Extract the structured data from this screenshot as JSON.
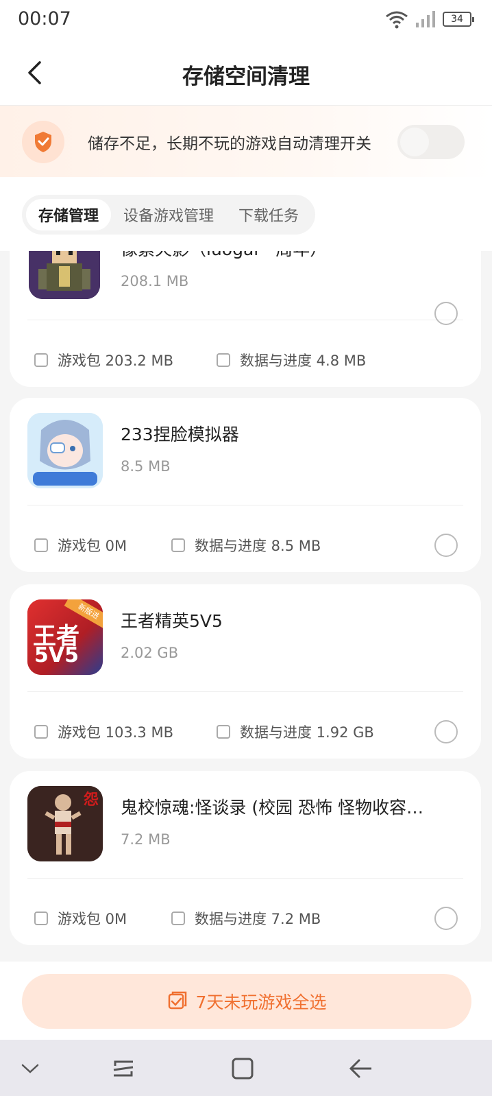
{
  "status_bar": {
    "time": "00:07",
    "battery": "34"
  },
  "header": {
    "title": "存储空间清理"
  },
  "notice": {
    "text": "储存不足，长期不玩的游戏自动清理开关",
    "toggle_on": false
  },
  "tabs": [
    {
      "label": "存储管理",
      "active": true
    },
    {
      "label": "设备游戏管理",
      "active": false
    },
    {
      "label": "下载任务",
      "active": false
    }
  ],
  "games": [
    {
      "name": "像素火影（luogal一周年）",
      "size": "208.1 MB",
      "package": "游戏包 203.2 MB",
      "data": "数据与进度 4.8 MB"
    },
    {
      "name": "233捏脸模拟器",
      "size": "8.5 MB",
      "package": "游戏包 0M",
      "data": "数据与进度 8.5 MB"
    },
    {
      "name": "王者精英5V5",
      "size": "2.02 GB",
      "package": "游戏包 103.3 MB",
      "data": "数据与进度 1.92 GB",
      "badge": "新版进"
    },
    {
      "name": "鬼校惊魂:怪谈录 (校园 恐怖 怪物收容…",
      "size": "7.2 MB",
      "package": "游戏包 0M",
      "data": "数据与进度 7.2 MB"
    }
  ],
  "icon_text": {
    "game3_main": "王者",
    "game3_sub": "5V5",
    "game4_corner": "怨"
  },
  "bottom": {
    "select_all_label": "7天未玩游戏全选"
  },
  "colors": {
    "accent": "#f07030",
    "accent_light": "#ffe7da"
  }
}
